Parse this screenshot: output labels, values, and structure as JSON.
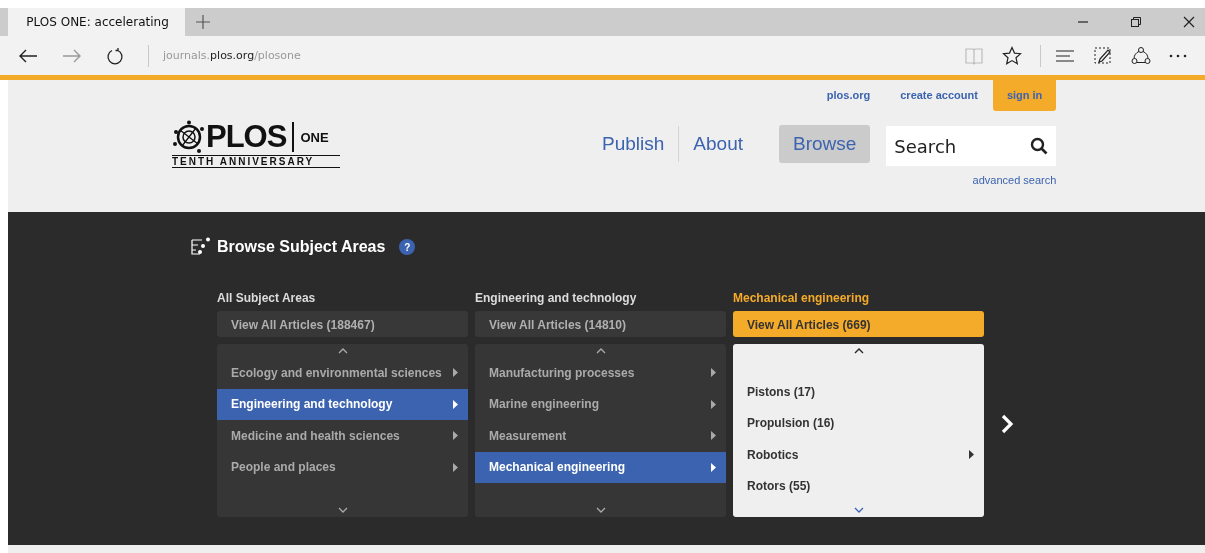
{
  "browser": {
    "tab": {
      "title": "PLOS ONE: accelerating",
      "selected": true
    },
    "address": {
      "prefix": "journals.",
      "domain": "plos.org",
      "path": "/plosone"
    }
  },
  "header": {
    "top_links": [
      {
        "label": "plos.org",
        "kind": "link"
      },
      {
        "label": "create account",
        "kind": "link"
      },
      {
        "label": "sign in",
        "kind": "button"
      }
    ],
    "logo": {
      "name": "PLOS",
      "journal": "ONE",
      "tagline": "TENTH ANNIVERSARY"
    },
    "nav": [
      {
        "label": "Publish",
        "selected": false
      },
      {
        "label": "About",
        "selected": false
      },
      {
        "label": "Browse",
        "selected": true
      }
    ],
    "search": {
      "placeholder": "Search"
    },
    "advanced_search": "advanced search"
  },
  "browse": {
    "title": "Browse Subject Areas",
    "help": "?",
    "columns": [
      {
        "heading": "All Subject Areas",
        "active": false,
        "view_all": "View All Articles (188467)",
        "items": [
          {
            "label": "Ecology and environmental sciences",
            "selected": false,
            "has_children": true
          },
          {
            "label": "Engineering and technology",
            "selected": true,
            "has_children": true
          },
          {
            "label": "Medicine and health sciences",
            "selected": false,
            "has_children": true
          },
          {
            "label": "People and places",
            "selected": false,
            "has_children": true
          }
        ]
      },
      {
        "heading": "Engineering and technology",
        "active": false,
        "view_all": "View All Articles (14810)",
        "items": [
          {
            "label": "Manufacturing processes",
            "selected": false,
            "has_children": true
          },
          {
            "label": "Marine engineering",
            "selected": false,
            "has_children": true
          },
          {
            "label": "Measurement",
            "selected": false,
            "has_children": true
          },
          {
            "label": "Mechanical engineering",
            "selected": true,
            "has_children": true
          }
        ]
      },
      {
        "heading": "Mechanical engineering",
        "active": true,
        "view_all": "View All Articles (669)",
        "items": [
          {
            "label": "Pistons (17)",
            "selected": false,
            "has_children": false
          },
          {
            "label": "Propulsion (16)",
            "selected": false,
            "has_children": false
          },
          {
            "label": "Robotics",
            "selected": false,
            "has_children": true
          },
          {
            "label": "Rotors (55)",
            "selected": false,
            "has_children": false
          }
        ]
      }
    ]
  }
}
